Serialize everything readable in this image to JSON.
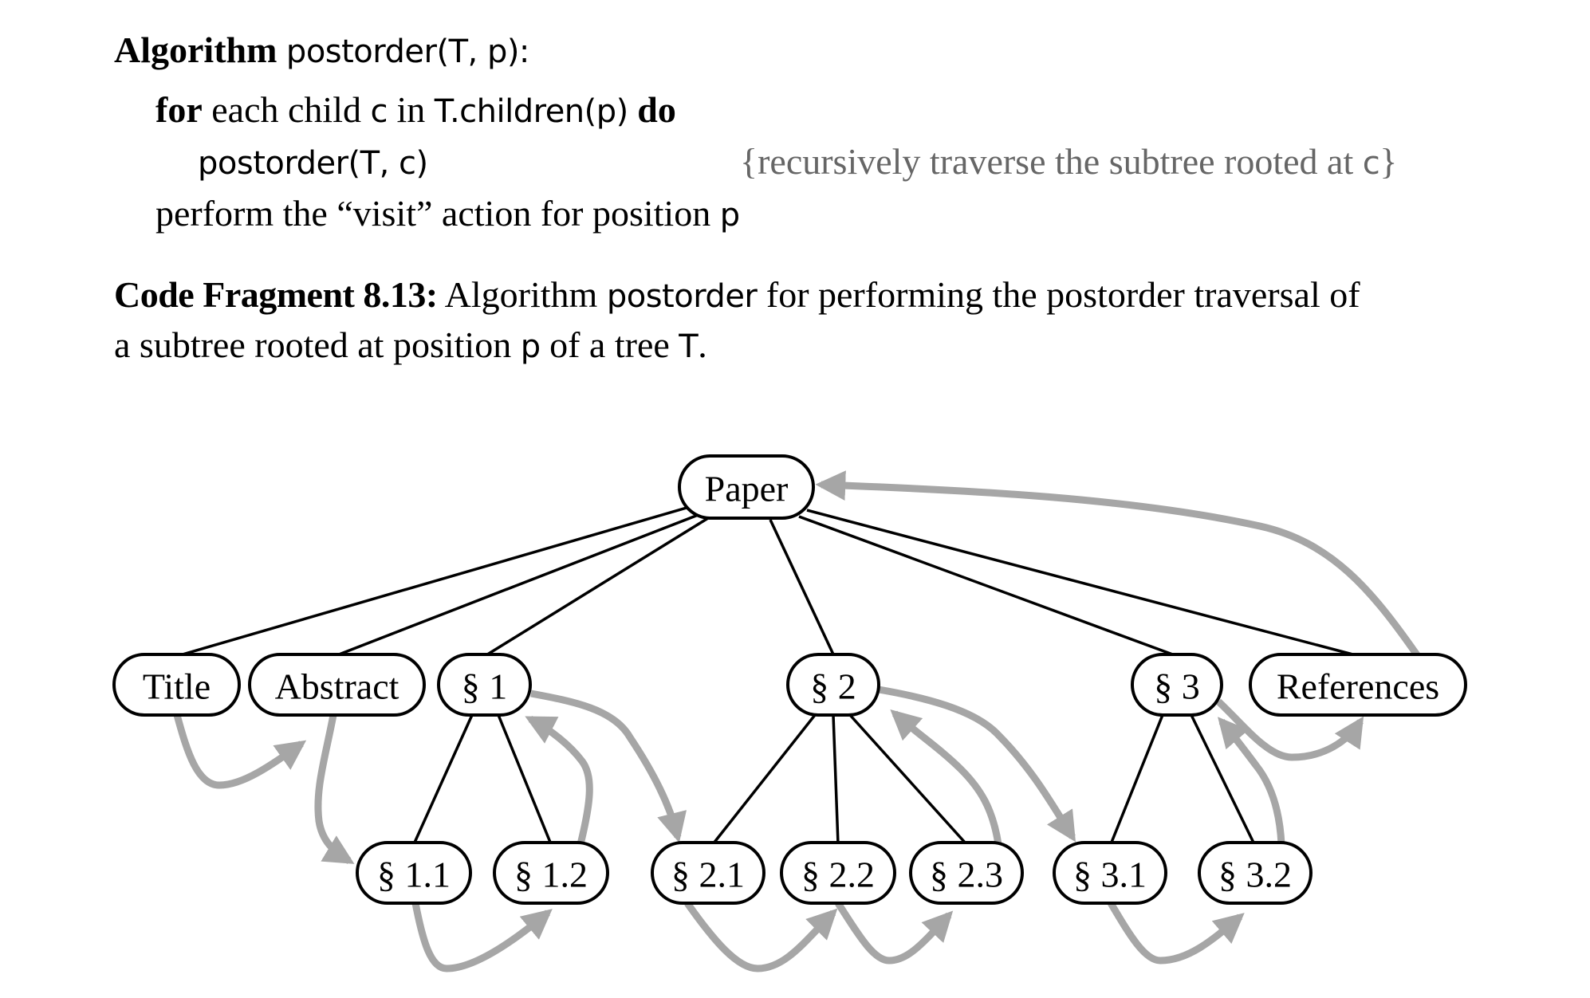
{
  "algorithm": {
    "header_keyword": "Algorithm",
    "header_signature": "postorder(T, p):",
    "line2_keyword_for": "for",
    "line2_text": "each child ",
    "line2_code_c": "c",
    "line2_in": " in ",
    "line2_code_children": "T.children(p)",
    "line2_keyword_do": "do",
    "line3_code": "postorder(T, c)",
    "line3_comment": "{recursively traverse the subtree rooted at ",
    "line3_comment_code": "c",
    "line3_comment_close": "}",
    "line4_text": "perform the “visit” action for position ",
    "line4_code": "p"
  },
  "caption": {
    "label": "Code Fragment 8.13:",
    "text_a": " Algorithm ",
    "code_postorder": "postorder",
    "text_b": " for performing the postorder traversal of",
    "text_c": "a subtree rooted at position ",
    "code_p": "p",
    "text_d": " of a tree ",
    "code_T": "T",
    "text_e": "."
  },
  "tree": {
    "nodes": [
      {
        "id": "paper",
        "label": "Paper",
        "parent": null
      },
      {
        "id": "title",
        "label": "Title",
        "parent": "paper"
      },
      {
        "id": "abstract",
        "label": "Abstract",
        "parent": "paper"
      },
      {
        "id": "s1",
        "label": "§ 1",
        "parent": "paper"
      },
      {
        "id": "s2",
        "label": "§ 2",
        "parent": "paper"
      },
      {
        "id": "s3",
        "label": "§ 3",
        "parent": "paper"
      },
      {
        "id": "refs",
        "label": "References",
        "parent": "paper"
      },
      {
        "id": "s11",
        "label": "§ 1.1",
        "parent": "s1"
      },
      {
        "id": "s12",
        "label": "§ 1.2",
        "parent": "s1"
      },
      {
        "id": "s21",
        "label": "§ 2.1",
        "parent": "s2"
      },
      {
        "id": "s22",
        "label": "§ 2.2",
        "parent": "s2"
      },
      {
        "id": "s23",
        "label": "§ 2.3",
        "parent": "s2"
      },
      {
        "id": "s31",
        "label": "§ 3.1",
        "parent": "s3"
      },
      {
        "id": "s32",
        "label": "§ 3.2",
        "parent": "s3"
      }
    ],
    "traversal_order": [
      "title",
      "abstract",
      "s11",
      "s12",
      "s1",
      "s21",
      "s22",
      "s23",
      "s2",
      "s31",
      "s32",
      "s3",
      "refs",
      "paper"
    ],
    "colors": {
      "edge": "#000000",
      "traversal_arrow": "#a6a6a6"
    }
  }
}
